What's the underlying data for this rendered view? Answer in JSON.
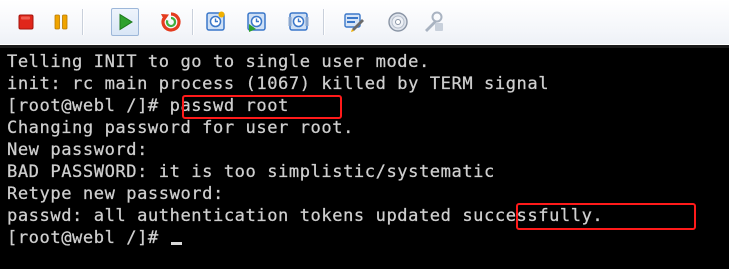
{
  "toolbar": {
    "buttons": [
      {
        "name": "stop",
        "icon": "stop-icon",
        "color": "#e0261a"
      },
      {
        "name": "pause",
        "icon": "pause-icon",
        "color": "#f0a400"
      },
      {
        "name": "play",
        "icon": "play-icon",
        "color": "#2ea12e"
      },
      {
        "name": "reset",
        "icon": "reset-icon",
        "color": "#e43c1f"
      },
      {
        "name": "snapshot",
        "icon": "snapshot-icon",
        "color": "#3a77c9"
      },
      {
        "name": "revert-snapshot",
        "icon": "revert-snapshot-icon",
        "color": "#3a77c9"
      },
      {
        "name": "snapshot-manager",
        "icon": "snapshot-manager-icon",
        "color": "#3a77c9"
      },
      {
        "name": "settings",
        "icon": "vm-settings-icon",
        "color": "#3a77c9"
      },
      {
        "name": "cd-dvd",
        "icon": "disc-icon",
        "color": "#8a95a5"
      },
      {
        "name": "tools",
        "icon": "tools-icon",
        "color": "#a9b3c1"
      }
    ]
  },
  "console": {
    "lines": [
      "Telling INIT to go to single user mode.",
      "init: rc main process (1067) killed by TERM signal",
      "[root@webl /]# passwd root",
      "Changing password for user root.",
      "New password:",
      "BAD PASSWORD: it is too simplistic/systematic",
      "Retype new password:",
      "passwd: all authentication tokens updated successfully.",
      "[root@webl /]# "
    ],
    "highlights": [
      "passwd root",
      "successfully."
    ],
    "colors": {
      "background": "#000000",
      "text": "#cfcfcf",
      "highlight": "#ff1a1a"
    }
  }
}
